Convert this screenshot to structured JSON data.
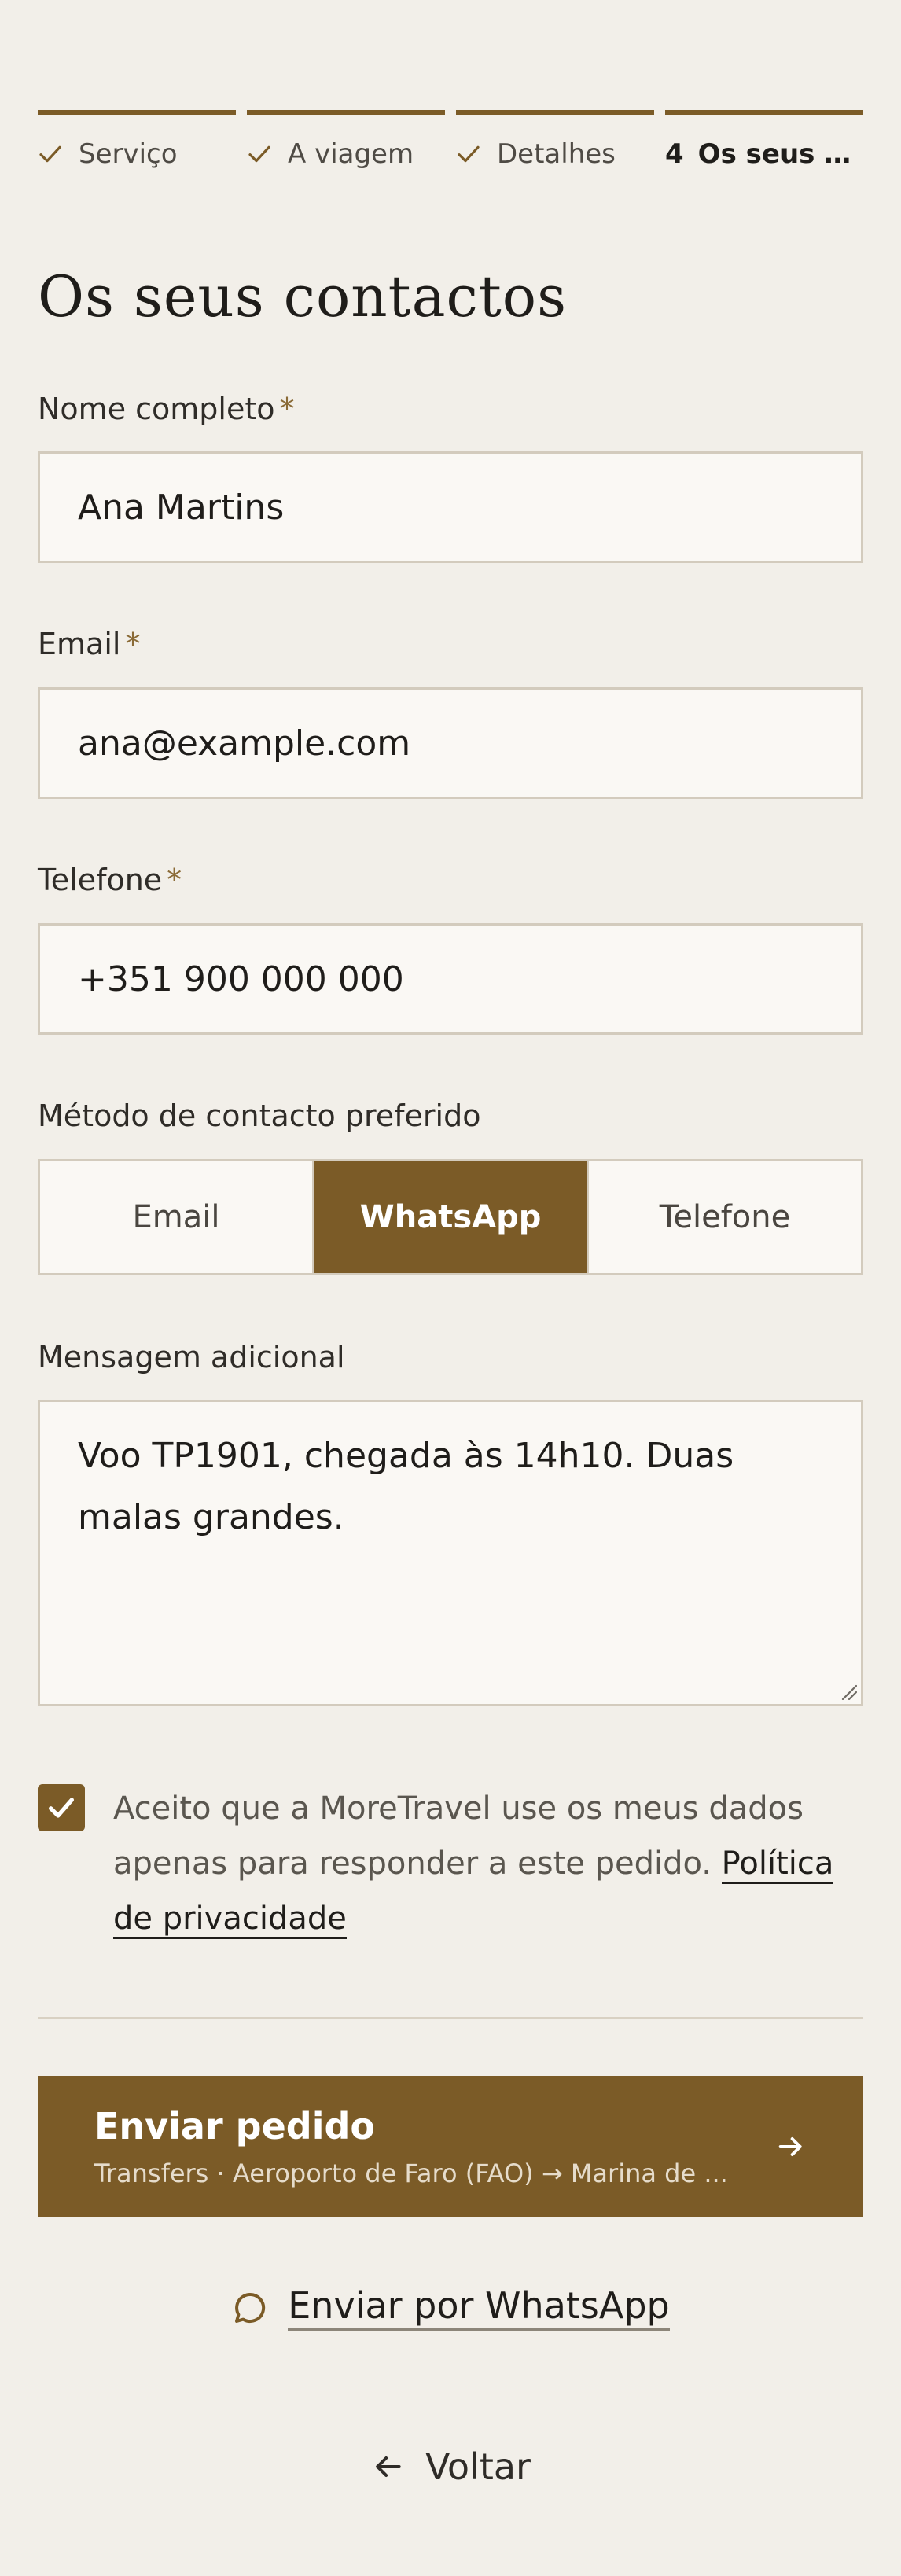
{
  "stepper": {
    "steps": [
      {
        "label": "Serviço",
        "state": "done"
      },
      {
        "label": "A viagem",
        "state": "done"
      },
      {
        "label": "Detalhes",
        "state": "done"
      },
      {
        "number": "4",
        "label": "Os seus co...",
        "state": "active"
      }
    ]
  },
  "page": {
    "title": "Os seus contactos"
  },
  "form": {
    "name": {
      "label": "Nome completo",
      "required_mark": "*",
      "value": "Ana Martins"
    },
    "email": {
      "label": "Email",
      "required_mark": "*",
      "value": "ana@example.com"
    },
    "phone": {
      "label": "Telefone",
      "required_mark": "*",
      "value": "+351 900 000 000"
    },
    "contact_method": {
      "label": "Método de contacto preferido",
      "options": [
        "Email",
        "WhatsApp",
        "Telefone"
      ],
      "selected": "WhatsApp"
    },
    "message": {
      "label": "Mensagem adicional",
      "value": "Voo TP1901, chegada às 14h10. Duas malas grandes."
    },
    "consent": {
      "checked": true,
      "text": "Aceito que a MoreTravel use os meus dados apenas para responder a este pedido. ",
      "link_text": "Política de privacidade"
    }
  },
  "actions": {
    "submit_label": "Enviar pedido",
    "submit_summary": "Transfers · Aeroporto de Faro (FAO) → Marina de ...",
    "whatsapp_label": "Enviar por WhatsApp",
    "back_label": "Voltar"
  },
  "colors": {
    "accent": "#7b5b27",
    "background": "#f2efe9",
    "field_bg": "#faf8f4",
    "border": "#d3cbbd"
  }
}
